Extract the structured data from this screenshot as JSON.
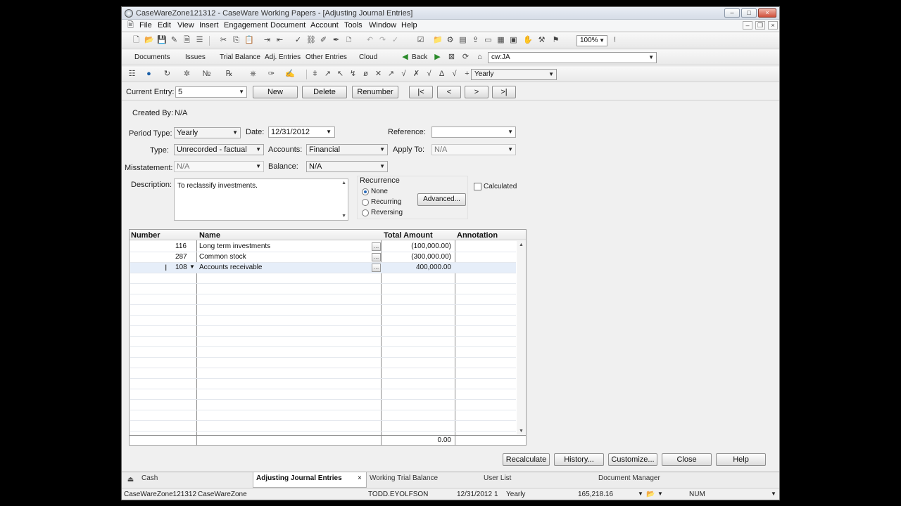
{
  "window": {
    "title": "CaseWareZone121312 - CaseWare Working Papers - [Adjusting Journal Entries]",
    "controls": [
      "–",
      "□",
      "×"
    ],
    "mdi_controls": [
      "–",
      "❐",
      "×"
    ]
  },
  "menu": [
    "File",
    "Edit",
    "View",
    "Insert",
    "Engagement",
    "Document",
    "Account",
    "Tools",
    "Window",
    "Help"
  ],
  "toolbar1": {
    "zoom": "100%",
    "alert": "!"
  },
  "toolbar2": {
    "nav": [
      "Documents",
      "Issues",
      "Trial Balance",
      "Adj. Entries",
      "Other Entries",
      "Cloud"
    ],
    "back": "Back",
    "address": "cw:JA"
  },
  "toolbar3": {
    "period": "Yearly"
  },
  "entry_bar": {
    "current_entry_label": "Current Entry:",
    "current_entry": "5",
    "new": "New",
    "delete": "Delete",
    "renumber": "Renumber",
    "first": "|<",
    "prev": "<",
    "next": ">",
    "last": ">|"
  },
  "form": {
    "created_by_label": "Created By:",
    "created_by": "N/A",
    "period_type_label": "Period Type:",
    "period_type": "Yearly",
    "date_label": "Date:",
    "date": "12/31/2012",
    "reference_label": "Reference:",
    "reference": "",
    "type_label": "Type:",
    "type": "Unrecorded - factual",
    "accounts_label": "Accounts:",
    "accounts": "Financial",
    "apply_to_label": "Apply To:",
    "apply_to": "N/A",
    "misstatement_label": "Misstatement:",
    "misstatement": "N/A",
    "balance_label": "Balance:",
    "balance": "N/A",
    "description_label": "Description:",
    "description": "To reclassify investments.",
    "recurrence_label": "Recurrence",
    "recurrence_options": [
      "None",
      "Recurring",
      "Reversing"
    ],
    "advanced": "Advanced...",
    "calculated": "Calculated"
  },
  "grid": {
    "headers": [
      "Number",
      "Name",
      "Total Amount",
      "Annotation"
    ],
    "rows": [
      {
        "number": "116",
        "name": "Long term investments",
        "amount": "(100,000.00)"
      },
      {
        "number": "287",
        "name": "Common stock",
        "amount": "(300,000.00)"
      },
      {
        "number": "108",
        "name": "Accounts receivable",
        "amount": "400,000.00"
      }
    ],
    "total": "0.00"
  },
  "actions": [
    "Recalculate",
    "History...",
    "Customize...",
    "Close",
    "Help"
  ],
  "tabs": [
    "Cash",
    "Adjusting Journal Entries",
    "Working Trial Balance",
    "User List",
    "Document Manager"
  ],
  "status": {
    "file": "CaseWareZone121312",
    "app": "CaseWareZone",
    "user": "TODD.EYOLFSON",
    "date": "12/31/2012",
    "period_num": "1",
    "period": "Yearly",
    "amount": "165,218.16",
    "num": "NUM"
  },
  "icons": [
    "app-icon",
    "new-icon",
    "open-icon",
    "save-icon",
    "print-icon",
    "cut-icon",
    "copy-icon",
    "paste-icon",
    "globe-icon",
    "back-arrow-icon",
    "cloud-icon"
  ]
}
